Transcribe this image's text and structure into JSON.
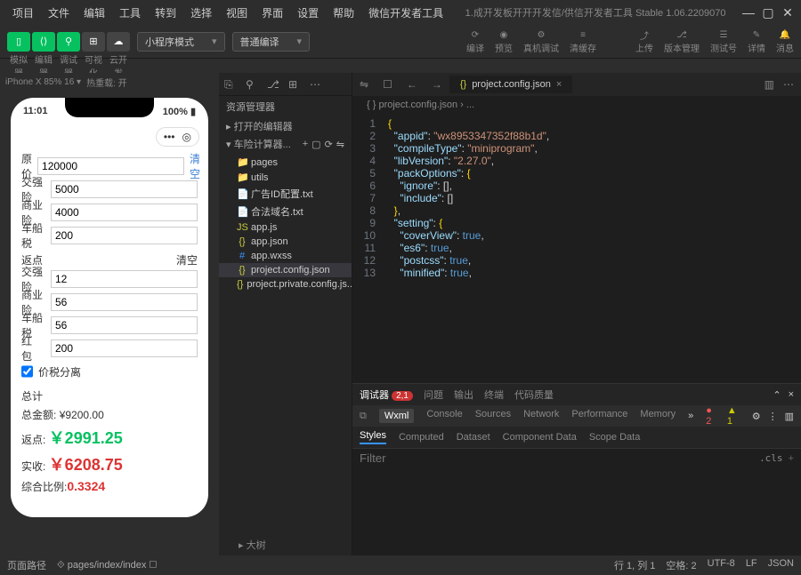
{
  "menu": [
    "项目",
    "文件",
    "编辑",
    "工具",
    "转到",
    "选择",
    "视图",
    "界面",
    "设置",
    "帮助",
    "微信开发者工具"
  ],
  "window_title": "1.成开发板开开开发信/供信开发者工具 Stable 1.06.2209070",
  "toolbar": {
    "labels": [
      "模拟器",
      "编辑器",
      "调试器",
      "可视化",
      "云开发"
    ],
    "select1": "小程序模式",
    "select2": "普通编译",
    "actions": [
      {
        "icon": "⟳",
        "label": "编译"
      },
      {
        "icon": "◉",
        "label": "预览"
      },
      {
        "icon": "⚙",
        "label": "真机调试"
      },
      {
        "icon": "≡",
        "label": "清缓存"
      }
    ],
    "right_actions": [
      {
        "icon": "⤴",
        "label": "上传"
      },
      {
        "icon": "⎇",
        "label": "版本管理"
      },
      {
        "icon": "☰",
        "label": "测试号"
      },
      {
        "icon": "✎",
        "label": "详情"
      },
      {
        "icon": "🔔",
        "label": "消息"
      }
    ]
  },
  "sim": {
    "device": "iPhone X 85% 16 ▾",
    "hot": "热重载: 开",
    "time": "11:01",
    "battery": "100%",
    "capsule_dots": "•••",
    "capsule_circle": "◎",
    "form": {
      "original_label": "原价",
      "original_value": "120000",
      "clear": "清空",
      "jqx_label": "交强险",
      "jqx_value": "5000",
      "syx_label": "商业险",
      "syx_value": "4000",
      "ccs_label": "车船税",
      "ccs_value": "200",
      "rebate_title": "返点",
      "r_jqx_label": "交强险",
      "r_jqx_value": "12",
      "r_syx_label": "商业险",
      "r_syx_value": "56",
      "r_ccs_label": "车船税",
      "r_ccs_value": "56",
      "hb_label": "红 包",
      "hb_value": "200",
      "split_label": "价税分离",
      "total_title": "总计",
      "total_amount_label": "总金额:",
      "total_amount": "¥9200.00",
      "rebate_label": "返点:",
      "rebate_value": "￥2991.25",
      "actual_label": "实收:",
      "actual_value": "￥6208.75",
      "ratio_label": "综合比例:",
      "ratio_value": "0.3324"
    }
  },
  "explorer": {
    "title": "资源管理器",
    "open_editors": "▸ 打开的编辑器",
    "project": "▾ 车险计算器...",
    "tree": [
      {
        "icon": "📁",
        "name": "pages",
        "color": "#c09553"
      },
      {
        "icon": "📁",
        "name": "utils",
        "color": "#6a9955"
      },
      {
        "icon": "📄",
        "name": "广告ID配置.txt",
        "color": "#3794ff"
      },
      {
        "icon": "📄",
        "name": "合法域名.txt",
        "color": "#3794ff"
      },
      {
        "icon": "JS",
        "name": "app.js",
        "color": "#cbcb41"
      },
      {
        "icon": "{}",
        "name": "app.json",
        "color": "#cbcb41"
      },
      {
        "icon": "#",
        "name": "app.wxss",
        "color": "#3794ff"
      },
      {
        "icon": "{}",
        "name": "project.config.json",
        "color": "#cbcb41",
        "sel": true
      },
      {
        "icon": "{}",
        "name": "project.private.config.js...",
        "color": "#cbcb41"
      }
    ]
  },
  "editor": {
    "tab_icon": "{}",
    "tab_name": "project.config.json",
    "crumb": "{ } project.config.json › ...",
    "lines": [
      {
        "n": 1,
        "html": "<span class='c-brace'>{</span>"
      },
      {
        "n": 2,
        "html": "  <span class='c-key'>\"appid\"</span><span class='c-punc'>: </span><span class='c-str'>\"wx8953347352f88b1d\"</span><span class='c-punc'>,</span>"
      },
      {
        "n": 3,
        "html": "  <span class='c-key'>\"compileType\"</span><span class='c-punc'>: </span><span class='c-str'>\"miniprogram\"</span><span class='c-punc'>,</span>"
      },
      {
        "n": 4,
        "html": "  <span class='c-key'>\"libVersion\"</span><span class='c-punc'>: </span><span class='c-str'>\"2.27.0\"</span><span class='c-punc'>,</span>"
      },
      {
        "n": 5,
        "html": "  <span class='c-key'>\"packOptions\"</span><span class='c-punc'>: </span><span class='c-brace'>{</span>"
      },
      {
        "n": 6,
        "html": "    <span class='c-key'>\"ignore\"</span><span class='c-punc'>: []</span><span class='c-punc'>,</span>"
      },
      {
        "n": 7,
        "html": "    <span class='c-key'>\"include\"</span><span class='c-punc'>: []</span>"
      },
      {
        "n": 8,
        "html": "  <span class='c-brace'>}</span><span class='c-punc'>,</span>"
      },
      {
        "n": 9,
        "html": "  <span class='c-key'>\"setting\"</span><span class='c-punc'>: </span><span class='c-brace'>{</span>"
      },
      {
        "n": 10,
        "html": "    <span class='c-key'>\"coverView\"</span><span class='c-punc'>: </span><span class='c-bool'>true</span><span class='c-punc'>,</span>"
      },
      {
        "n": 11,
        "html": "    <span class='c-key'>\"es6\"</span><span class='c-punc'>: </span><span class='c-bool'>true</span><span class='c-punc'>,</span>"
      },
      {
        "n": 12,
        "html": "    <span class='c-key'>\"postcss\"</span><span class='c-punc'>: </span><span class='c-bool'>true</span><span class='c-punc'>,</span>"
      },
      {
        "n": 13,
        "html": "    <span class='c-key'>\"minified\"</span><span class='c-punc'>: </span><span class='c-bool'>true</span><span class='c-punc'>,</span>"
      }
    ]
  },
  "debug": {
    "tabs": [
      "调试器",
      "问题",
      "输出",
      "终端",
      "代码质量"
    ],
    "badge": "2,1",
    "devtabs": [
      "Wxml",
      "Console",
      "Sources",
      "Network",
      "Performance",
      "Memory"
    ],
    "errs": "● 2",
    "warns": "▲ 1",
    "subtabs": [
      "Styles",
      "Computed",
      "Dataset",
      "Component Data",
      "Scope Data"
    ],
    "filter_placeholder": "Filter",
    "cls": ".cls",
    "plus": "+"
  },
  "dashi": "▸ 大树",
  "status": {
    "path_label": "页面路径",
    "path": "pages/index/index",
    "pos": "行 1, 列 1",
    "spaces": "空格: 2",
    "enc": "UTF-8",
    "eol": "LF",
    "lang": "JSON"
  }
}
